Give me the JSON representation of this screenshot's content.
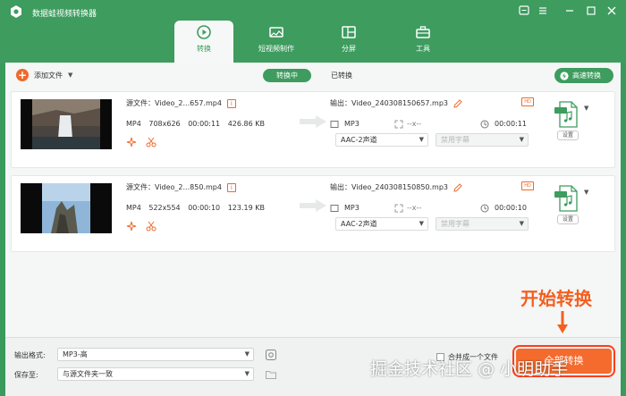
{
  "app": {
    "title": "数据蛙视频转换器"
  },
  "tabs": [
    {
      "label": "转换",
      "icon": "convert-icon",
      "active": true
    },
    {
      "label": "短视频制作",
      "icon": "video-maker-icon",
      "active": false
    },
    {
      "label": "分屏",
      "icon": "split-screen-icon",
      "active": false
    },
    {
      "label": "工具",
      "icon": "toolbox-icon",
      "active": false
    }
  ],
  "toolbar": {
    "add_file": "添加文件",
    "subtab_converting": "转换中",
    "subtab_converted": "已转换",
    "high_speed": "高速转换"
  },
  "files": [
    {
      "source_label": "源文件：",
      "source_name": "Video_2...657.mp4",
      "format": "MP4",
      "resolution": "708x626",
      "duration": "00:00:11",
      "size": "426.86 KB",
      "output_label": "输出：",
      "output_name": "Video_240308150657.mp3",
      "output_format": "MP3",
      "output_resolution": "--x--",
      "output_duration": "00:00:11",
      "audio_track": "AAC-2声道",
      "subtitle": "禁用字幕",
      "settings": "设置",
      "format_badge": "MP3"
    },
    {
      "source_label": "源文件：",
      "source_name": "Video_2...850.mp4",
      "format": "MP4",
      "resolution": "522x554",
      "duration": "00:00:10",
      "size": "123.19 KB",
      "output_label": "输出：",
      "output_name": "Video_240308150850.mp3",
      "output_format": "MP3",
      "output_resolution": "--x--",
      "output_duration": "00:00:10",
      "audio_track": "AAC-2声道",
      "subtitle": "禁用字幕",
      "settings": "设置",
      "format_badge": "MP3"
    }
  ],
  "bottom": {
    "output_format_label": "输出格式:",
    "output_format_value": "MP3-高",
    "save_to_label": "保存至:",
    "save_to_value": "与源文件夹一致",
    "merge_label": "合并成一个文件",
    "convert_all": "全部转换"
  },
  "annotation": {
    "text": "开始转换"
  },
  "watermark": {
    "text": "掘金技术社区 @ 小明助手"
  },
  "colors": {
    "brand_green": "#3d9c5e",
    "accent_orange": "#f46b2d",
    "annotation_red": "#f45f1f"
  }
}
